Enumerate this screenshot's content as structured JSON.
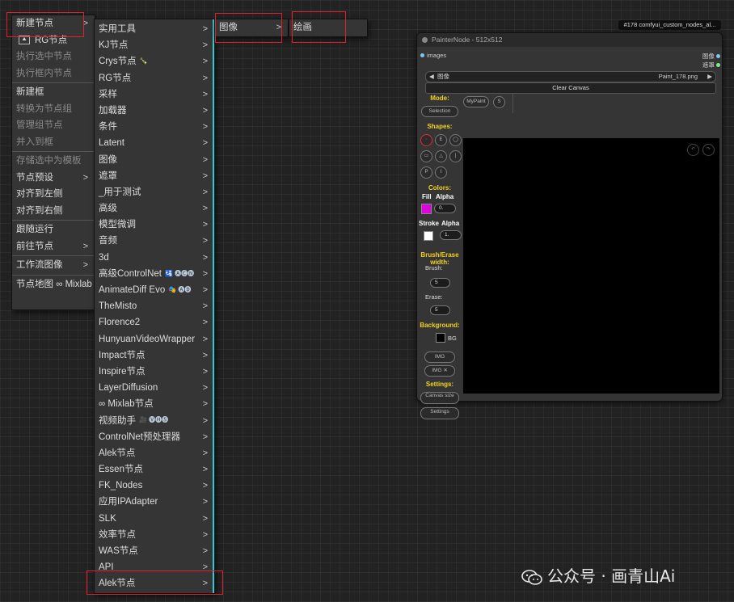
{
  "menu1": {
    "items": [
      {
        "label": "新建节点",
        "arrow": ">",
        "disabled": false
      },
      {
        "label": "RG节点",
        "arrow": "",
        "disabled": false,
        "icon": true
      },
      {
        "label": "执行选中节点",
        "arrow": "",
        "disabled": true
      },
      {
        "label": "执行框内节点",
        "arrow": "",
        "disabled": true
      },
      {
        "sep": true
      },
      {
        "label": "新建框",
        "arrow": "",
        "disabled": false
      },
      {
        "label": "转换为节点组",
        "arrow": "",
        "disabled": true
      },
      {
        "label": "管理组节点",
        "arrow": "",
        "disabled": true
      },
      {
        "label": "并入到框",
        "arrow": "",
        "disabled": true
      },
      {
        "sep": true
      },
      {
        "label": "存储选中为模板",
        "arrow": "",
        "disabled": true
      },
      {
        "label": "节点预设",
        "arrow": ">",
        "disabled": false
      },
      {
        "label": "对齐到左侧",
        "arrow": "",
        "disabled": false
      },
      {
        "label": "对齐到右侧",
        "arrow": "",
        "disabled": false
      },
      {
        "sep": true
      },
      {
        "label": "跟随运行",
        "arrow": "",
        "disabled": false
      },
      {
        "label": "前往节点",
        "arrow": ">",
        "disabled": false
      },
      {
        "sep": true
      },
      {
        "label": "工作流图像",
        "arrow": ">",
        "disabled": false
      },
      {
        "sep": true
      },
      {
        "label": "节点地图 ∞ Mixlab",
        "arrow": "",
        "disabled": false
      }
    ]
  },
  "menu2": {
    "items": [
      {
        "label": "实用工具",
        "badge": ""
      },
      {
        "label": "KJ节点",
        "badge": ""
      },
      {
        "label": "Crys节点",
        "badge": "🍾"
      },
      {
        "label": "RG节点",
        "badge": ""
      },
      {
        "label": "采样",
        "badge": ""
      },
      {
        "label": "加载器",
        "badge": ""
      },
      {
        "label": "条件",
        "badge": ""
      },
      {
        "label": "Latent",
        "badge": ""
      },
      {
        "label": "图像",
        "badge": ""
      },
      {
        "label": "遮罩",
        "badge": ""
      },
      {
        "label": "_用于测试",
        "badge": ""
      },
      {
        "label": "高级",
        "badge": ""
      },
      {
        "label": "模型微调",
        "badge": ""
      },
      {
        "label": "音频",
        "badge": ""
      },
      {
        "label": "3d",
        "badge": ""
      },
      {
        "label": "高级ControlNet",
        "badge": "🛂 🅐🅒🅝"
      },
      {
        "label": "AnimateDiff Evo",
        "badge": "🎭 🅐🅓"
      },
      {
        "label": "TheMisto",
        "badge": ""
      },
      {
        "label": "Florence2",
        "badge": ""
      },
      {
        "label": "HunyuanVideoWrapper",
        "badge": ""
      },
      {
        "label": "Impact节点",
        "badge": ""
      },
      {
        "label": "Inspire节点",
        "badge": ""
      },
      {
        "label": "LayerDiffusion",
        "badge": ""
      },
      {
        "label": "∞ Mixlab节点",
        "badge": ""
      },
      {
        "label": "视频助手",
        "badge": "🎥 🅥🅗🅢"
      },
      {
        "label": "ControlNet预处理器",
        "badge": ""
      },
      {
        "label": "Alek节点",
        "badge": ""
      },
      {
        "label": "Essen节点",
        "badge": ""
      },
      {
        "label": "FK_Nodes",
        "badge": ""
      },
      {
        "label": "应用IPAdapter",
        "badge": ""
      },
      {
        "label": "SLK",
        "badge": ""
      },
      {
        "label": "效率节点",
        "badge": ""
      },
      {
        "label": "WAS节点",
        "badge": ""
      },
      {
        "label": "API",
        "badge": ""
      },
      {
        "label": "Alek节点",
        "badge": ""
      }
    ]
  },
  "menu3": {
    "label": "图像",
    "arrow": ">"
  },
  "menu4": {
    "label": "绘画"
  },
  "node": {
    "title": "PainterNode - 512x512",
    "tag": "#178 comfyui_custom_nodes_al...",
    "images_label": "images",
    "out_image": "图像",
    "out_mask": "遮罩",
    "file_label": "图像",
    "file_value": "Paint_178.png",
    "clear_canvas": "Clear Canvas",
    "mode": "Mode:",
    "mypaint": "MyPaint",
    "s_btn": "S",
    "selection": "Selection",
    "shapes": "Shapes:",
    "colors": "Colors:",
    "fill": "Fill",
    "alpha": "Alpha",
    "alpha_value": "0.",
    "stroke": "Stroke",
    "alpha2": "Alpha",
    "alpha2_value": "1.",
    "brush_title": "Brush/Erase width:",
    "brush": "Brush:",
    "brush_value": "5",
    "erase": "Erase:",
    "erase_value": "5",
    "background": "Background:",
    "bg": "BG",
    "img_btn": "IMG",
    "img_x_btn": "IMG ✕",
    "settings_title": "Settings:",
    "canvas_size": "Canvas size",
    "settings_btn": "Settings",
    "fill_color": "#e000e0",
    "stroke_color": "#ffffff",
    "bg_color": "#000000"
  },
  "watermark": "公众号 · 画青山Ai"
}
